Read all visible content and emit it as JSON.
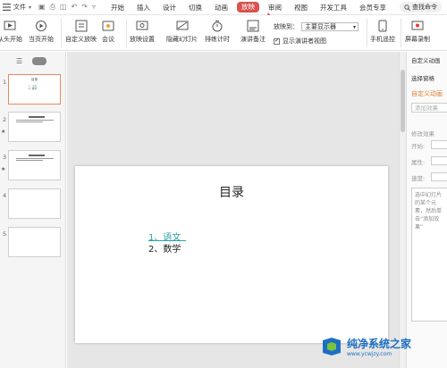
{
  "menubar": {
    "file_label": "文件",
    "tabs": [
      "开始",
      "插入",
      "设计",
      "切换",
      "动画",
      "放映",
      "审阅",
      "视图",
      "开发工具",
      "会员专享"
    ],
    "active_tab": "放映",
    "search_label": "查找命令"
  },
  "ribbon": {
    "from_start": "从头开始",
    "from_current": "当页开始",
    "custom_show": "自定义放映",
    "meeting": "会议",
    "show_settings": "放映设置",
    "hide_slide": "隐藏幻灯片",
    "rehearse": "排练计时",
    "speaker_notes": "演讲备注",
    "show_on_label": "放映到：",
    "show_on_value": "主要显示器",
    "presenter_view": "显示演讲者视图",
    "phone_remote": "手机遥控",
    "screen_record": "屏幕录制"
  },
  "slides": [
    {
      "num": "1",
      "title": "目录",
      "lines": [
        "1、语文",
        "2、数学"
      ]
    },
    {
      "num": "2",
      "starred": true
    },
    {
      "num": "3",
      "starred": true
    },
    {
      "num": "4"
    },
    {
      "num": "5"
    }
  ],
  "main_slide": {
    "title": "目录",
    "line1": "1、语文",
    "line2": "2、数学"
  },
  "right_panel": {
    "header": "自定义动画",
    "select_pane": "选择窗格",
    "custom_anim": "自定义动画",
    "add_effect": "添加效果",
    "modify_effect": "修改效果",
    "start_label": "开始:",
    "property_label": "属性:",
    "speed_label": "速度:",
    "hint": "选中幻灯片的某个元素，然后单击“添加效果”"
  },
  "watermark": {
    "title": "纯净系统之家",
    "url": "www.ycwjzy.com"
  },
  "colors": {
    "active_tab": "#d9534f",
    "accent_teal": "#2aa1a1",
    "selected_thumb": "#e8875e"
  }
}
